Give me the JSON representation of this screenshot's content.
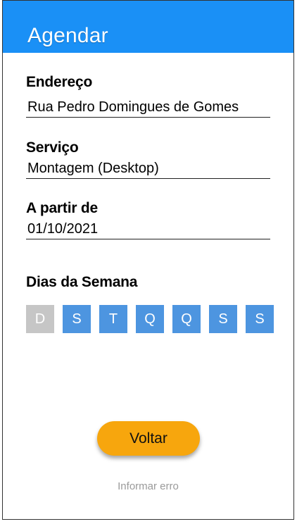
{
  "header": {
    "title": "Agendar"
  },
  "form": {
    "endereco": {
      "label": "Endereço",
      "value": "Rua Pedro Domingues de Gomes"
    },
    "servico": {
      "label": "Serviço",
      "value": "Montagem (Desktop)"
    },
    "a_partir_de": {
      "label": "A partir de",
      "value": "01/10/2021"
    }
  },
  "weekdays": {
    "label": "Dias da Semana",
    "days": [
      {
        "letter": "D",
        "selected": false
      },
      {
        "letter": "S",
        "selected": true
      },
      {
        "letter": "T",
        "selected": true
      },
      {
        "letter": "Q",
        "selected": true
      },
      {
        "letter": "Q",
        "selected": true
      },
      {
        "letter": "S",
        "selected": true
      },
      {
        "letter": "S",
        "selected": true
      }
    ]
  },
  "actions": {
    "back_label": "Voltar",
    "report_label": "Informar erro"
  },
  "colors": {
    "appbar": "#1a90f6",
    "day_selected": "#4d95e0",
    "day_unselected": "#c6c6c6",
    "back_button": "#f7a60d",
    "report_text": "#9a9a9a"
  }
}
